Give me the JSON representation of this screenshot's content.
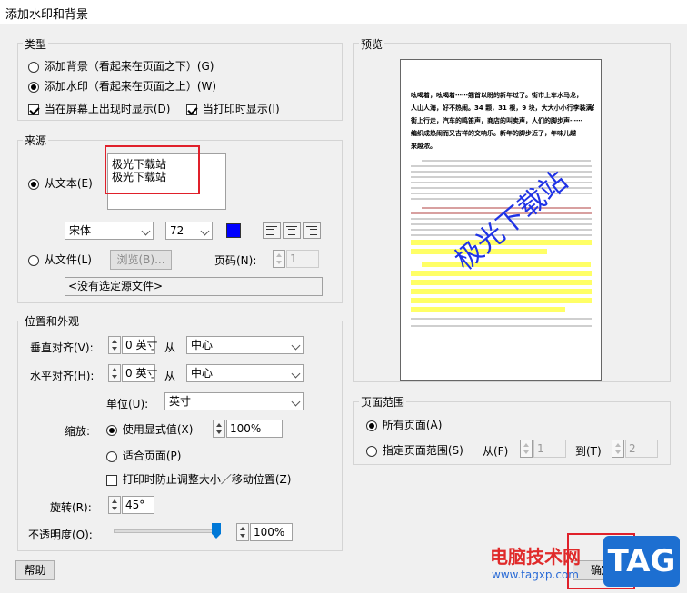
{
  "window": {
    "title": "添加水印和背景"
  },
  "type_group": {
    "title": "类型",
    "add_background": "添加背景（看起来在页面之下）(G)",
    "add_watermark": "添加水印（看起来在页面之上）(W)",
    "show_on_screen": "当在屏幕上出现时显示(D)",
    "show_on_print": "当打印时显示(I)"
  },
  "source_group": {
    "title": "来源",
    "from_text": "从文本(E)",
    "text_line1": "极光下载站",
    "text_line2": "极光下载站",
    "font": "宋体",
    "font_size": "72",
    "color": "#0000ff",
    "from_file": "从文件(L)",
    "browse": "浏览(B)...",
    "page_no_label": "页码(N):",
    "page_no": "1",
    "no_source": "<没有选定源文件>"
  },
  "position_group": {
    "title": "位置和外观",
    "vertical_label": "垂直对齐(V):",
    "vertical_value": "0 英寸",
    "from1": "从",
    "vertical_from": "中心",
    "horizontal_label": "水平对齐(H):",
    "horizontal_value": "0 英寸",
    "from2": "从",
    "horizontal_from": "中心",
    "unit_label": "单位(U):",
    "unit": "英寸",
    "scale_label": "缩放:",
    "use_display": "使用显式值(X)",
    "scale_value": "100%",
    "fit_page": "适合页面(P)",
    "prevent_resize": "打印时防止调整大小／移动位置(Z)",
    "rotate_label": "旋转(R):",
    "rotate_value": "45°",
    "opacity_label": "不透明度(O):",
    "opacity_value": "100%",
    "opacity_level": 1.0
  },
  "preview": {
    "title": "预览",
    "heading_lines": [
      "吆喝着，吆喝着⋯⋯翘首以盼的新年过了。街市上车水马龙，",
      "人山人海，好不热闹。34 颗，31 根，9 块，大大小小行李装满的人在",
      "街上行走，汽车的鸣笛声，商店的叫卖声，人们的脚步声⋯⋯",
      "编织成热闹而又吉祥的交响乐。新年的脚步近了，年味儿越",
      "来越浓。"
    ],
    "watermark": "极光下载站"
  },
  "page_range": {
    "title": "页面范围",
    "all_pages": "所有页面(A)",
    "specify": "指定页面范围(S)",
    "from_label": "从(F)",
    "from_value": "1",
    "to_label": "到(T)",
    "to_value": "2"
  },
  "footer": {
    "help": "帮助",
    "ok": "确定",
    "site_name": "电脑技术网",
    "site_url": "www.tagxp.com",
    "tag": "TAG"
  }
}
